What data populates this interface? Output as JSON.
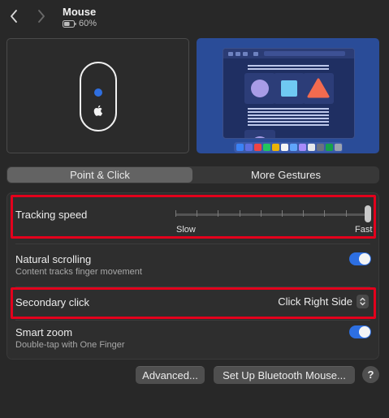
{
  "header": {
    "title": "Mouse",
    "battery": "60%",
    "battery_level": 0.6
  },
  "tabs": [
    {
      "label": "Point & Click",
      "selected": true
    },
    {
      "label": "More Gestures",
      "selected": false
    }
  ],
  "settings": {
    "tracking_speed": {
      "label": "Tracking speed",
      "min_label": "Slow",
      "max_label": "Fast",
      "value": 1.0
    },
    "natural_scrolling": {
      "label": "Natural scrolling",
      "description": "Content tracks finger movement",
      "on": true
    },
    "secondary_click": {
      "label": "Secondary click",
      "value": "Click Right Side"
    },
    "smart_zoom": {
      "label": "Smart zoom",
      "description": "Double-tap with One Finger",
      "on": true
    }
  },
  "buttons": {
    "advanced": "Advanced...",
    "bluetooth": "Set Up Bluetooth Mouse...",
    "help": "?"
  },
  "colors": {
    "accent": "#2d6fe2",
    "highlight": "#e3001c",
    "background": "#282828"
  }
}
